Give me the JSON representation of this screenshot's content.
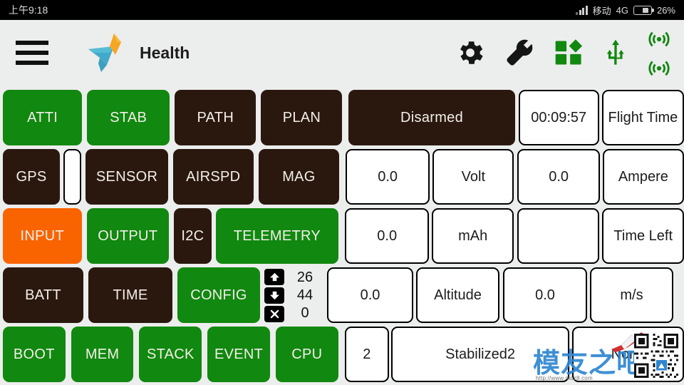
{
  "statusbar": {
    "time": "上午9:18",
    "carrier": "移动",
    "network": "4G",
    "battery_percent": "26%",
    "signal_icon": "signal-bars-icon",
    "battery_icon": "battery-icon"
  },
  "header": {
    "menu_icon": "hamburger-menu-icon",
    "logo_icon": "bird-logo-icon",
    "title": "Health",
    "icons": [
      {
        "name": "gear-icon",
        "label": "Settings",
        "color": "#1a1a1a"
      },
      {
        "name": "wrench-icon",
        "label": "Tools",
        "color": "#1a1a1a"
      },
      {
        "name": "widgets-icon",
        "label": "Widgets",
        "color": "#11880f"
      },
      {
        "name": "usb-icon",
        "label": "USB",
        "color": "#11880f"
      },
      {
        "name": "wireless-icon",
        "label": "Wireless",
        "color": "#11880f"
      },
      {
        "name": "telemetry-signal-icon",
        "label": "Telemetry Link",
        "color": "#11880f"
      }
    ]
  },
  "colors": {
    "green": "#11880f",
    "dark": "#2a180f",
    "orange": "#fa6400",
    "page_bg": "#eceded",
    "cell_bg": "#ffffff"
  },
  "status_buttons": {
    "row1": [
      {
        "label": "ATTI",
        "state": "green"
      },
      {
        "label": "STAB",
        "state": "green"
      },
      {
        "label": "PATH",
        "state": "dark"
      },
      {
        "label": "PLAN",
        "state": "dark"
      }
    ],
    "row2": [
      {
        "label": "GPS",
        "state": "dark"
      },
      {
        "label": "SENSOR",
        "state": "dark"
      },
      {
        "label": "AIRSPD",
        "state": "dark"
      },
      {
        "label": "MAG",
        "state": "dark"
      }
    ],
    "row3": [
      {
        "label": "INPUT",
        "state": "orange"
      },
      {
        "label": "OUTPUT",
        "state": "green"
      },
      {
        "label": "I2C",
        "state": "dark"
      },
      {
        "label": "TELEMETRY",
        "state": "green"
      }
    ],
    "row4": [
      {
        "label": "BATT",
        "state": "dark"
      },
      {
        "label": "TIME",
        "state": "dark"
      },
      {
        "label": "CONFIG",
        "state": "green"
      }
    ],
    "row5": [
      {
        "label": "BOOT",
        "state": "green"
      },
      {
        "label": "MEM",
        "state": "green"
      },
      {
        "label": "STACK",
        "state": "green"
      },
      {
        "label": "EVENT",
        "state": "green"
      },
      {
        "label": "CPU",
        "state": "green"
      }
    ]
  },
  "sat_indicator": {
    "name": "satellite-count-indicator",
    "value": ""
  },
  "stepper": {
    "up_icon": "arrow-up-icon",
    "down_icon": "arrow-down-icon",
    "close_icon": "close-x-icon",
    "up_value": "26",
    "down_value": "44",
    "close_value": "0"
  },
  "telemetry": {
    "armed_status": "Disarmed",
    "flight_time_value": "00:09:57",
    "flight_time_label": "Flight Time",
    "rows": [
      {
        "value_a": "0.0",
        "label_a": "Volt",
        "value_b": "0.0",
        "label_b": "Ampere"
      },
      {
        "value_a": "0.0",
        "label_a": "mAh",
        "value_b": "",
        "label_b": "Time Left"
      },
      {
        "value_a": "0.0",
        "label_a": "Altitude",
        "value_b": "0.0",
        "label_b": "m/s"
      }
    ],
    "bottom": {
      "mode_number": "2",
      "mode_name": "Stabilized2",
      "secondary": "None"
    }
  },
  "watermark": {
    "text": "模友之吧",
    "url": "http://www.moz8.com",
    "qr_icon": "qr-code-icon",
    "plane_icon": "airplane-icon"
  }
}
